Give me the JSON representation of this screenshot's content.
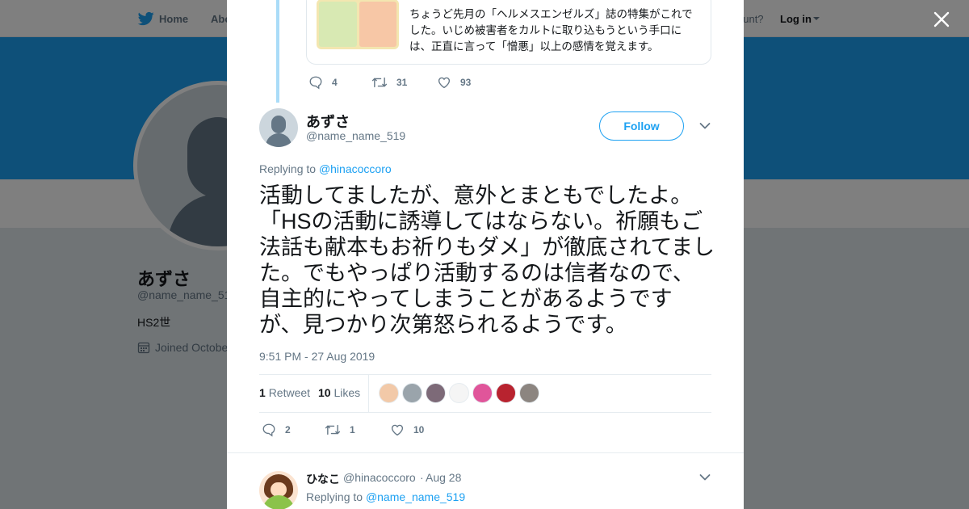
{
  "colors": {
    "accent": "#1da1f2",
    "banner": "#1da1f2",
    "muted": "#657786",
    "text": "#14171a"
  },
  "nav": {
    "logo_icon": "twitter-bird-icon",
    "home": "Home",
    "about": "Abo",
    "login_prompt": "ccount?",
    "login": "Log in"
  },
  "profile": {
    "name": "あずさ",
    "handle": "@name_name_51",
    "bio": "HS2世",
    "joined": "Joined Octobe"
  },
  "parent_tweet": {
    "quote_text": "ちょうど先月の「ヘルメスエンゼルズ」誌の特集がこれでした。いじめ被害者をカルトに取り込もうという手口には、正直に言って「憎悪」以上の感情を覚えます。",
    "replies": "4",
    "retweets": "31",
    "likes": "93"
  },
  "tweet": {
    "name": "あずさ",
    "handle": "@name_name_519",
    "follow_label": "Follow",
    "replying_prefix": "Replying to",
    "replying_to": "@hinacoccoro",
    "text": "活動してましたが、意外とまともでしたよ。「HSの活動に誘導してはならない。祈願もご法話も献本もお祈りもダメ」が徹底されてました。でもやっぱり活動するのは信者なので、自主的にやってしまうことがあるようですが、見つかり次第怒られるようです。",
    "timestamp": "9:51 PM - 27 Aug 2019",
    "retweet_count": "1",
    "retweet_label": "Retweet",
    "like_count": "10",
    "like_label": "Likes",
    "likers": [
      {
        "color": "#f2c9a8"
      },
      {
        "color": "#9aa4ab"
      },
      {
        "color": "#7d6a78"
      },
      {
        "color": "#f5f5f5"
      },
      {
        "color": "#e0559a"
      },
      {
        "color": "#b8232f"
      },
      {
        "color": "#8c8580"
      }
    ],
    "actions": {
      "replies": "2",
      "retweets": "1",
      "likes": "10"
    }
  },
  "reply": {
    "name": "ひなこ",
    "handle": "@hinacoccoro",
    "separator": "·",
    "date": "Aug 28",
    "replying_prefix": "Replying to",
    "replying_to": "@name_name_519"
  }
}
